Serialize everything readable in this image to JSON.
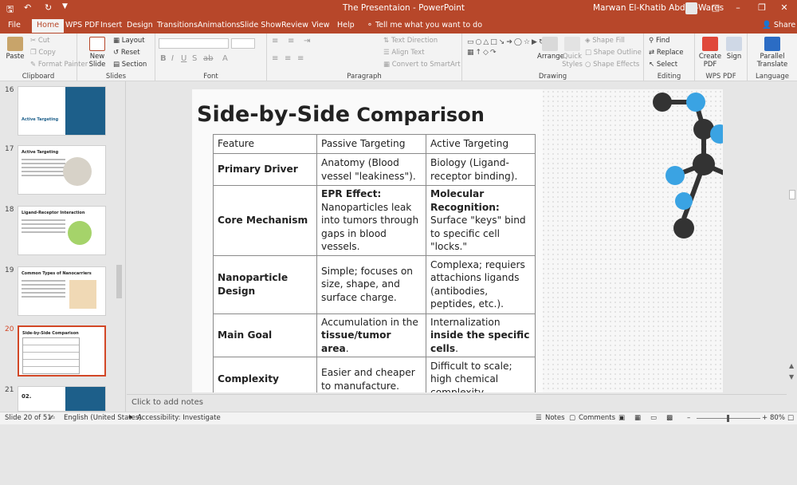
{
  "app": {
    "window_title": "The Presentaion  -  PowerPoint",
    "user_name": "Marwan El-Khatib Abd El-Wares",
    "tell_me": "Tell me what you want to do",
    "share": "Share"
  },
  "tabs": [
    "File",
    "Home",
    "WPS PDF",
    "Insert",
    "Design",
    "Transitions",
    "Animations",
    "Slide Show",
    "Review",
    "View",
    "Help"
  ],
  "active_tab": "Home",
  "ribbon": {
    "clipboard": {
      "label": "Clipboard",
      "paste": "Paste",
      "cut": "Cut",
      "copy": "Copy",
      "format_painter": "Format Painter"
    },
    "slides": {
      "label": "Slides",
      "new_slide": "New Slide",
      "layout": "Layout",
      "reset": "Reset",
      "section": "Section"
    },
    "font": {
      "label": "Font"
    },
    "paragraph": {
      "label": "Paragraph",
      "text_direction": "Text Direction",
      "align_text": "Align Text",
      "smartart": "Convert to SmartArt"
    },
    "drawing": {
      "label": "Drawing",
      "arrange": "Arrange",
      "quick_styles": "Quick Styles",
      "shape_fill": "Shape Fill",
      "shape_outline": "Shape Outline",
      "shape_effects": "Shape Effects"
    },
    "editing": {
      "label": "Editing",
      "find": "Find",
      "replace": "Replace",
      "select": "Select"
    },
    "wps_pdf": {
      "label": "WPS PDF",
      "create_pdf": "Create PDF",
      "sign": "Sign"
    },
    "language": {
      "label": "Language",
      "translate": "Parallel Translate"
    }
  },
  "thumbnails": [
    {
      "num": "16",
      "title": "Active Targeting"
    },
    {
      "num": "17",
      "title": "Active Targeting"
    },
    {
      "num": "18",
      "title": "Ligand-Receptor Interaction"
    },
    {
      "num": "19",
      "title": "Common Types of Nanocarriers"
    },
    {
      "num": "20",
      "title": "Side-by-Side Comparison"
    },
    {
      "num": "21",
      "title": "02."
    }
  ],
  "slide": {
    "title_part1": "Side-by-Side",
    "title_part2": " Comparison",
    "table": {
      "headers": [
        "Feature",
        "Passive Targeting",
        "Active Targeting"
      ],
      "rows": [
        {
          "feature": "Primary Driver",
          "passive": "Anatomy (Blood vessel \"leakiness\").",
          "active": "Biology (Ligand-receptor binding)."
        },
        {
          "feature": "Core Mechanism",
          "passive_bold": "EPR Effect:",
          "passive": " Nanoparticles leak into tumors through gaps in blood vessels.",
          "active_bold": "Molecular Recognition:",
          "active": " Surface \"keys\" bind to specific cell \"locks.\""
        },
        {
          "feature": "Nanoparticle Design",
          "passive": "Simple; focuses on size, shape, and surface charge.",
          "active": "Complexa; requiers attachions ligands (antibodies, peptides, etc.)."
        },
        {
          "feature": "Main Goal",
          "passive": "Accumulation in the ",
          "passive_bold": "tissue/tumor area",
          "passive_end": ".",
          "active": "Internalization ",
          "active_bold": "inside the specific cells",
          "active_end": "."
        },
        {
          "feature": "Complexity",
          "passive": "Easier and cheaper to manufacture.",
          "active": "Difficult to scale; high chemical complexity."
        }
      ]
    }
  },
  "notes_placeholder": "Click to add notes",
  "status": {
    "slide_of": "Slide 20 of 51",
    "language": "English (United States)",
    "accessibility": "Accessibility: Investigate",
    "notes": "Notes",
    "comments": "Comments",
    "zoom": "80%"
  },
  "colors": {
    "accent": "#b7472a",
    "selected_thumb": "#d24726",
    "molecule_blue": "#3aa3e3",
    "molecule_dark": "#333333"
  }
}
